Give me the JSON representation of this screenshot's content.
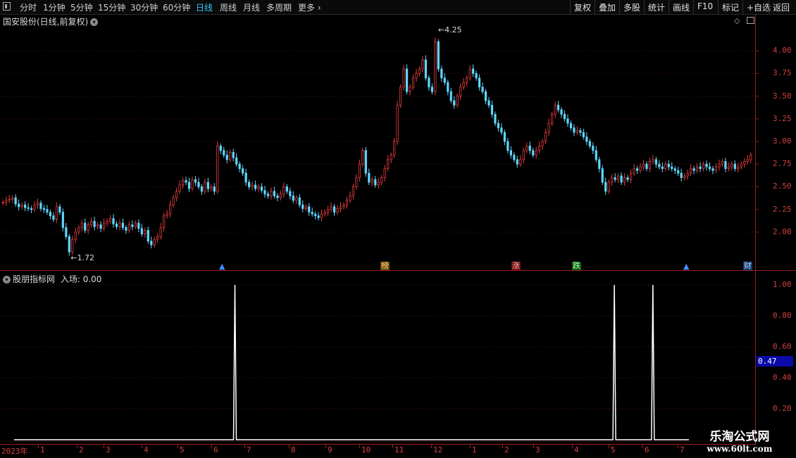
{
  "toolbar": {
    "periods": [
      "分时",
      "1分钟",
      "5分钟",
      "15分钟",
      "30分钟",
      "60分钟",
      "日线",
      "周线",
      "月线",
      "多周期",
      "更多"
    ],
    "active_period": "日线",
    "right_buttons": [
      "复权",
      "叠加",
      "多股",
      "统计",
      "画线",
      "F10",
      "标记",
      "+自选",
      "返回"
    ]
  },
  "main_chart": {
    "title": "国安股份(日线,前复权)",
    "y_ticks": [
      "4.00",
      "3.75",
      "3.50",
      "3.25",
      "3.00",
      "2.75",
      "2.50",
      "2.25",
      "2.00"
    ],
    "high_label": "4.25",
    "low_label": "1.72",
    "markers": [
      {
        "text": "▲",
        "kind": "blue-up"
      },
      {
        "text": "榜",
        "kind": "bang"
      },
      {
        "text": "涨",
        "kind": "zhang"
      },
      {
        "text": "跌",
        "kind": "die"
      },
      {
        "text": "▲",
        "kind": "blue-up"
      },
      {
        "text": "财",
        "kind": "cai"
      }
    ],
    "colors": {
      "up": "#e03c3c",
      "down": "#5fd7ff",
      "grid": "#5a1414",
      "axis": "#9b1c1c"
    }
  },
  "sub_chart": {
    "title": "股朋指标网",
    "value_label": "入场: 0.00",
    "y_ticks": [
      "1.00",
      "0.80",
      "0.60",
      "0.40",
      "0.20"
    ],
    "current_value": "0.47"
  },
  "date_axis": {
    "year_label": "2023年",
    "months": [
      "1",
      "2",
      "3",
      "4",
      "5",
      "6",
      "7",
      "8",
      "9",
      "10",
      "11",
      "12",
      "1",
      "2",
      "3",
      "4",
      "5",
      "6",
      "7"
    ]
  },
  "chart_data": [
    {
      "type": "candlestick",
      "title": "国安股份(日线,前复权)",
      "ylim": [
        1.72,
        4.25
      ],
      "y_ticks": [
        2.0,
        2.25,
        2.5,
        2.75,
        3.0,
        3.25,
        3.5,
        3.75,
        4.0
      ],
      "annotations": [
        {
          "label": "4.25",
          "kind": "high"
        },
        {
          "label": "1.72",
          "kind": "low"
        }
      ],
      "close_path": [
        2.33,
        2.35,
        2.36,
        2.38,
        2.31,
        2.28,
        2.3,
        2.27,
        2.26,
        2.25,
        2.3,
        2.32,
        2.26,
        2.25,
        2.22,
        2.18,
        2.14,
        2.28,
        2.22,
        2.05,
        1.95,
        1.78,
        1.92,
        2.0,
        2.05,
        2.1,
        2.02,
        2.08,
        2.12,
        2.06,
        2.08,
        2.04,
        2.1,
        2.12,
        2.15,
        2.09,
        2.06,
        2.1,
        2.05,
        2.02,
        2.08,
        2.06,
        2.1,
        2.04,
        1.98,
        2.02,
        1.9,
        1.86,
        1.92,
        1.95,
        2.05,
        2.18,
        2.2,
        2.3,
        2.38,
        2.45,
        2.52,
        2.57,
        2.55,
        2.48,
        2.58,
        2.55,
        2.5,
        2.45,
        2.55,
        2.48,
        2.5,
        2.45,
        2.95,
        2.9,
        2.85,
        2.8,
        2.88,
        2.82,
        2.75,
        2.7,
        2.65,
        2.55,
        2.5,
        2.52,
        2.48,
        2.5,
        2.46,
        2.42,
        2.4,
        2.45,
        2.4,
        2.38,
        2.42,
        2.5,
        2.45,
        2.4,
        2.35,
        2.38,
        2.3,
        2.26,
        2.28,
        2.22,
        2.2,
        2.18,
        2.16,
        2.2,
        2.22,
        2.25,
        2.28,
        2.22,
        2.26,
        2.28,
        2.3,
        2.35,
        2.4,
        2.5,
        2.6,
        2.75,
        2.9,
        2.65,
        2.55,
        2.58,
        2.52,
        2.55,
        2.6,
        2.7,
        2.8,
        2.85,
        3.0,
        3.4,
        3.6,
        3.8,
        3.55,
        3.6,
        3.7,
        3.75,
        3.8,
        3.9,
        3.7,
        3.6,
        3.55,
        4.1,
        3.8,
        3.7,
        3.65,
        3.55,
        3.45,
        3.4,
        3.5,
        3.6,
        3.65,
        3.7,
        3.8,
        3.75,
        3.7,
        3.6,
        3.55,
        3.45,
        3.4,
        3.3,
        3.2,
        3.15,
        3.1,
        3.0,
        2.9,
        2.85,
        2.8,
        2.75,
        2.8,
        2.9,
        2.95,
        2.9,
        2.85,
        2.9,
        2.95,
        3.0,
        3.1,
        3.2,
        3.3,
        3.4,
        3.35,
        3.3,
        3.25,
        3.2,
        3.15,
        3.1,
        3.12,
        3.1,
        3.05,
        3.0,
        2.95,
        2.9,
        2.8,
        2.7,
        2.55,
        2.45,
        2.55,
        2.6,
        2.58,
        2.62,
        2.55,
        2.6,
        2.58,
        2.65,
        2.7,
        2.68,
        2.72,
        2.75,
        2.7,
        2.78,
        2.8,
        2.75,
        2.72,
        2.7,
        2.75,
        2.72,
        2.7,
        2.68,
        2.65,
        2.6,
        2.62,
        2.65,
        2.7,
        2.68,
        2.72,
        2.7,
        2.75,
        2.72,
        2.7,
        2.68,
        2.72,
        2.75,
        2.78,
        2.7,
        2.72,
        2.75,
        2.7,
        2.72,
        2.75,
        2.78,
        2.8,
        2.85
      ]
    },
    {
      "type": "line",
      "title": "股朋指标网",
      "series": [
        {
          "name": "入场",
          "spikes_at_fraction": [
            0.298,
            0.81,
            0.862
          ],
          "baseline": 0,
          "peak": 1.0
        }
      ],
      "ylim": [
        0,
        1.0
      ],
      "y_ticks": [
        0.2,
        0.4,
        0.6,
        0.8,
        1.0
      ]
    }
  ],
  "watermark": {
    "main": "乐淘公式网",
    "url": "www.60lt.com"
  }
}
